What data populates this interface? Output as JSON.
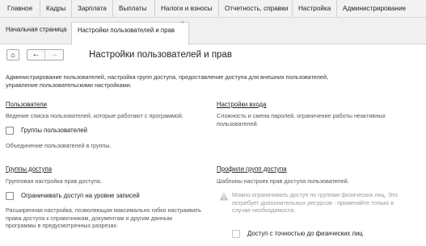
{
  "menubar": {
    "items": [
      "Главное",
      "Кадры",
      "Зарплата",
      "Выплаты",
      "Налоги и взносы",
      "Отчетность, справки",
      "Настройка",
      "Администрирование"
    ]
  },
  "tabs": {
    "home": "Начальная страница",
    "active": "Настройки пользователей и прав",
    "close_glyph": "×"
  },
  "nav": {
    "home_glyph": "⌂",
    "back_glyph": "←",
    "forward_glyph": "→"
  },
  "page": {
    "title": "Настройки пользователей и прав",
    "description": "Администрирование пользователей, настройка групп доступа, предоставление доступа для внешних пользователей, управление пользовательскими настройками."
  },
  "sections": {
    "users": {
      "title": "Пользователи",
      "text": "Ведение списка пользователей, которые работают с программой.",
      "checkbox_label": "Группы пользователей",
      "checkbox_checked": false,
      "checkbox_text": "Объединение пользователей в группы."
    },
    "login": {
      "title": "Настройки входа",
      "text": "Сложность и смена паролей, ограничение работы неактивных пользователей."
    },
    "access_groups": {
      "title": "Группы доступа",
      "text": "Групповая настройка прав доступа.",
      "checkbox_label": "Ограничивать доступ на уровне записей",
      "checkbox_checked": false,
      "checkbox_text": "Расширенная настройка, позволяющая максимально гибко настраивать права доступа к справочникам, документам и другим данным программы в предусмотренных разрезах."
    },
    "profiles": {
      "title": "Профили групп доступа",
      "text": "Шаблоны настроек прав доступа пользователей.",
      "warning_text": "Можно ограничивать доступ по группам физических лиц. Это потребует дополнительных ресурсов - применяйте только в случае необходимости.",
      "checkbox_label": "Доступ с точностью до физических лиц",
      "checkbox_checked": false
    }
  },
  "colors": {
    "menubar_bg": "#f2f2f2",
    "warning_icon": "#c8c8c8"
  }
}
